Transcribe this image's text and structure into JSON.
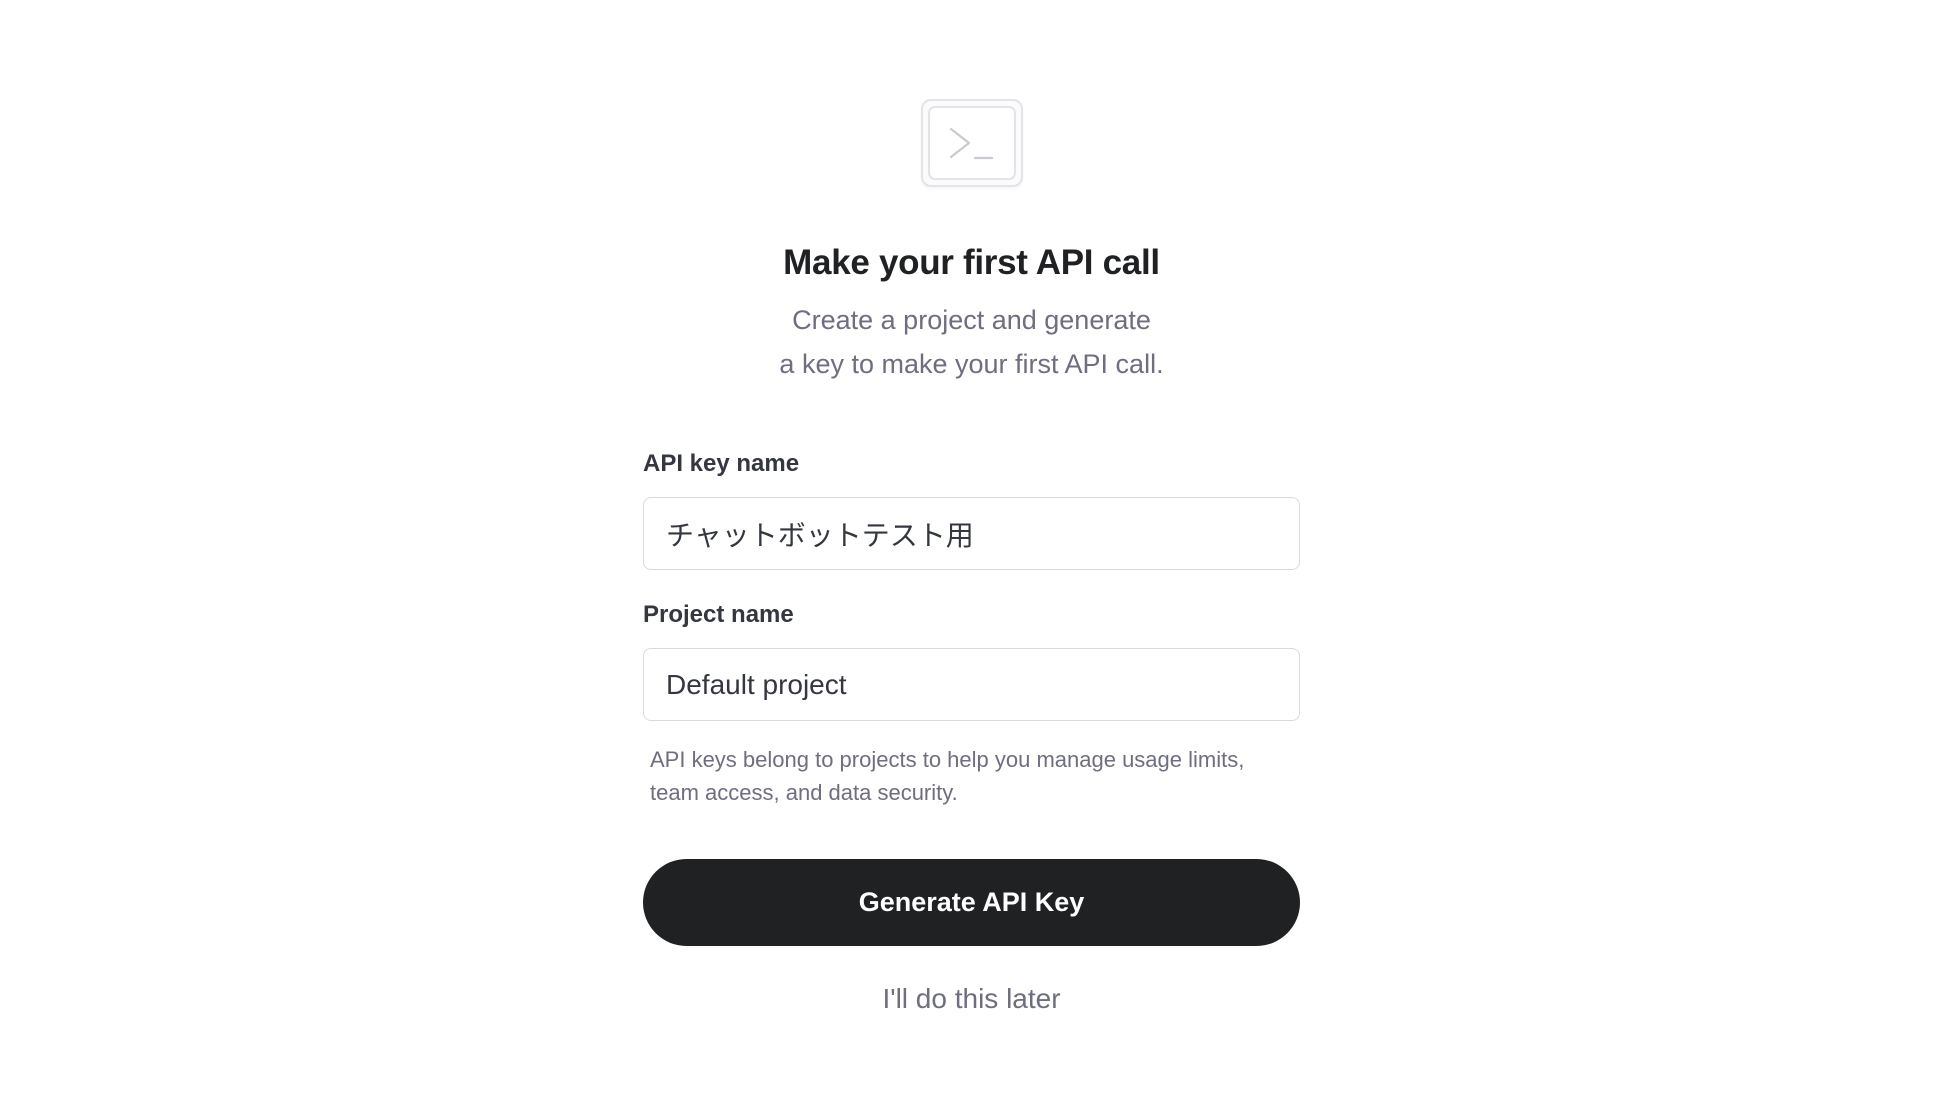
{
  "hero": {
    "icon": "terminal-icon",
    "title": "Make your first API call",
    "subtitle_line1": "Create a project and generate",
    "subtitle_line2": "a key to make your first API call."
  },
  "form": {
    "api_key_name": {
      "label": "API key name",
      "value": "チャットボットテスト用"
    },
    "project_name": {
      "label": "Project name",
      "value": "Default project"
    },
    "helper_text": "API keys belong to projects to help you manage usage limits, team access, and data security."
  },
  "actions": {
    "generate_label": "Generate API Key",
    "later_label": "I'll do this later"
  },
  "colors": {
    "primary_button": "#202123",
    "text_dark": "#202123",
    "text_muted": "#6e6e80",
    "border": "#d9d9e3"
  }
}
